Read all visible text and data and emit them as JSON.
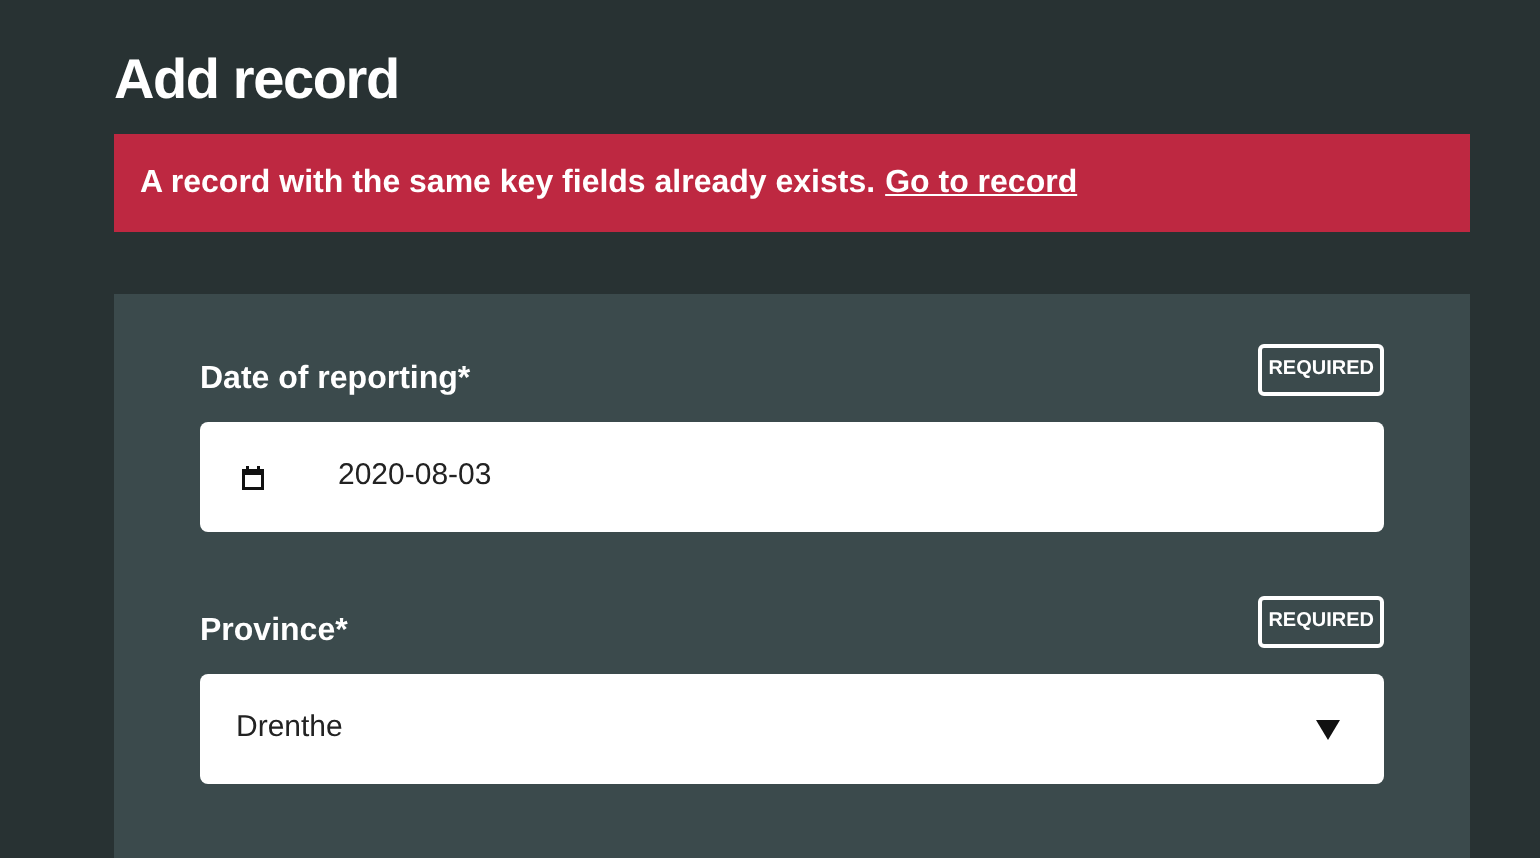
{
  "title": "Add record",
  "alert": {
    "message": "A record with the same key fields already exists.",
    "link": "Go to record"
  },
  "fields": [
    {
      "kind": "date",
      "label": "Date of reporting*",
      "badge": "REQUIRED",
      "value": "2020-08-03"
    },
    {
      "kind": "select",
      "label": "Province*",
      "badge": "REQUIRED",
      "value": "Drenthe"
    }
  ]
}
